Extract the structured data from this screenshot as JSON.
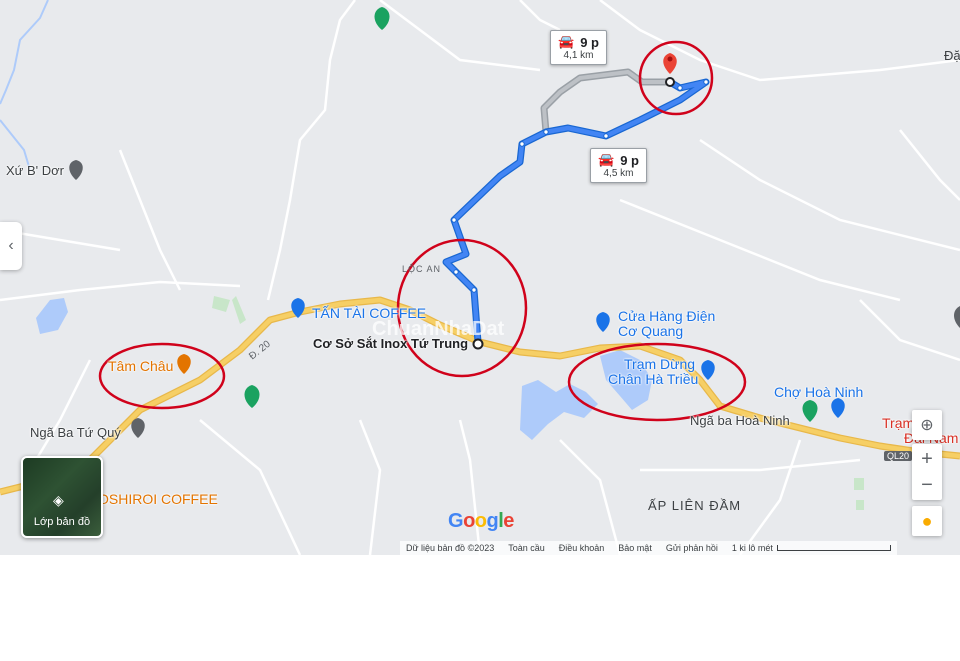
{
  "route_callouts": [
    {
      "time": "9 p",
      "distance": "4,1 km"
    },
    {
      "time": "9 p",
      "distance": "4,5 km"
    }
  ],
  "labels": {
    "tan_tai": "TẤN TÀI COFFEE",
    "co_so": "Cơ Sở Sắt Inox Tứ Trung",
    "loc_an": "LỘC AN",
    "cua_hang": "Cửa Hàng Điện",
    "co_quang": "Cơ Quang",
    "tram_dung": "Trạm Dừng",
    "chan_ha_trieu": "Chân Hà Triều",
    "cho_hoa_ninh": "Chợ Hoà Ninh",
    "nga_ba_hoa_ninh": "Ngã ba Hoà Ninh",
    "tram_partial": "Trạm",
    "dai_nam_partial": "Đại Nam",
    "tam_chau": "Tâm Châu",
    "nga_ba_tu_quy": "Ngã Ba Tứ Quý",
    "oshiroi": "OSHIROI COFFEE",
    "ap_lien_dam": "ẤP LIÊN ĐẦM",
    "xu_b_dor": "Xứ B' Dơr",
    "edge_right": "Đặ",
    "road_d20": "Đ. 20",
    "ql20": "QL20",
    "watermark": "ChuanNhaDat"
  },
  "layers_button": "Lớp bản đồ",
  "google_logo": [
    "G",
    "o",
    "o",
    "g",
    "l",
    "e"
  ],
  "google_colors": [
    "#4285f4",
    "#ea4335",
    "#fbbc05",
    "#4285f4",
    "#34a853",
    "#ea4335"
  ],
  "footer": {
    "data": "Dữ liệu bản đồ ©2023",
    "global": "Toàn cầu",
    "terms": "Điều khoản",
    "privacy": "Bảo mật",
    "feedback": "Gửi phản hồi",
    "scale": "1 ki lô mét"
  },
  "controls": {
    "zoom_in": "+",
    "zoom_out": "−",
    "collapse": "‹"
  },
  "colors": {
    "route_active": "#1a73e8",
    "route_alt": "#a0a4a8",
    "highway": "#f6cf65",
    "annotation": "#d0021b",
    "water": "#aecbfa",
    "destination": "#ea4335"
  }
}
